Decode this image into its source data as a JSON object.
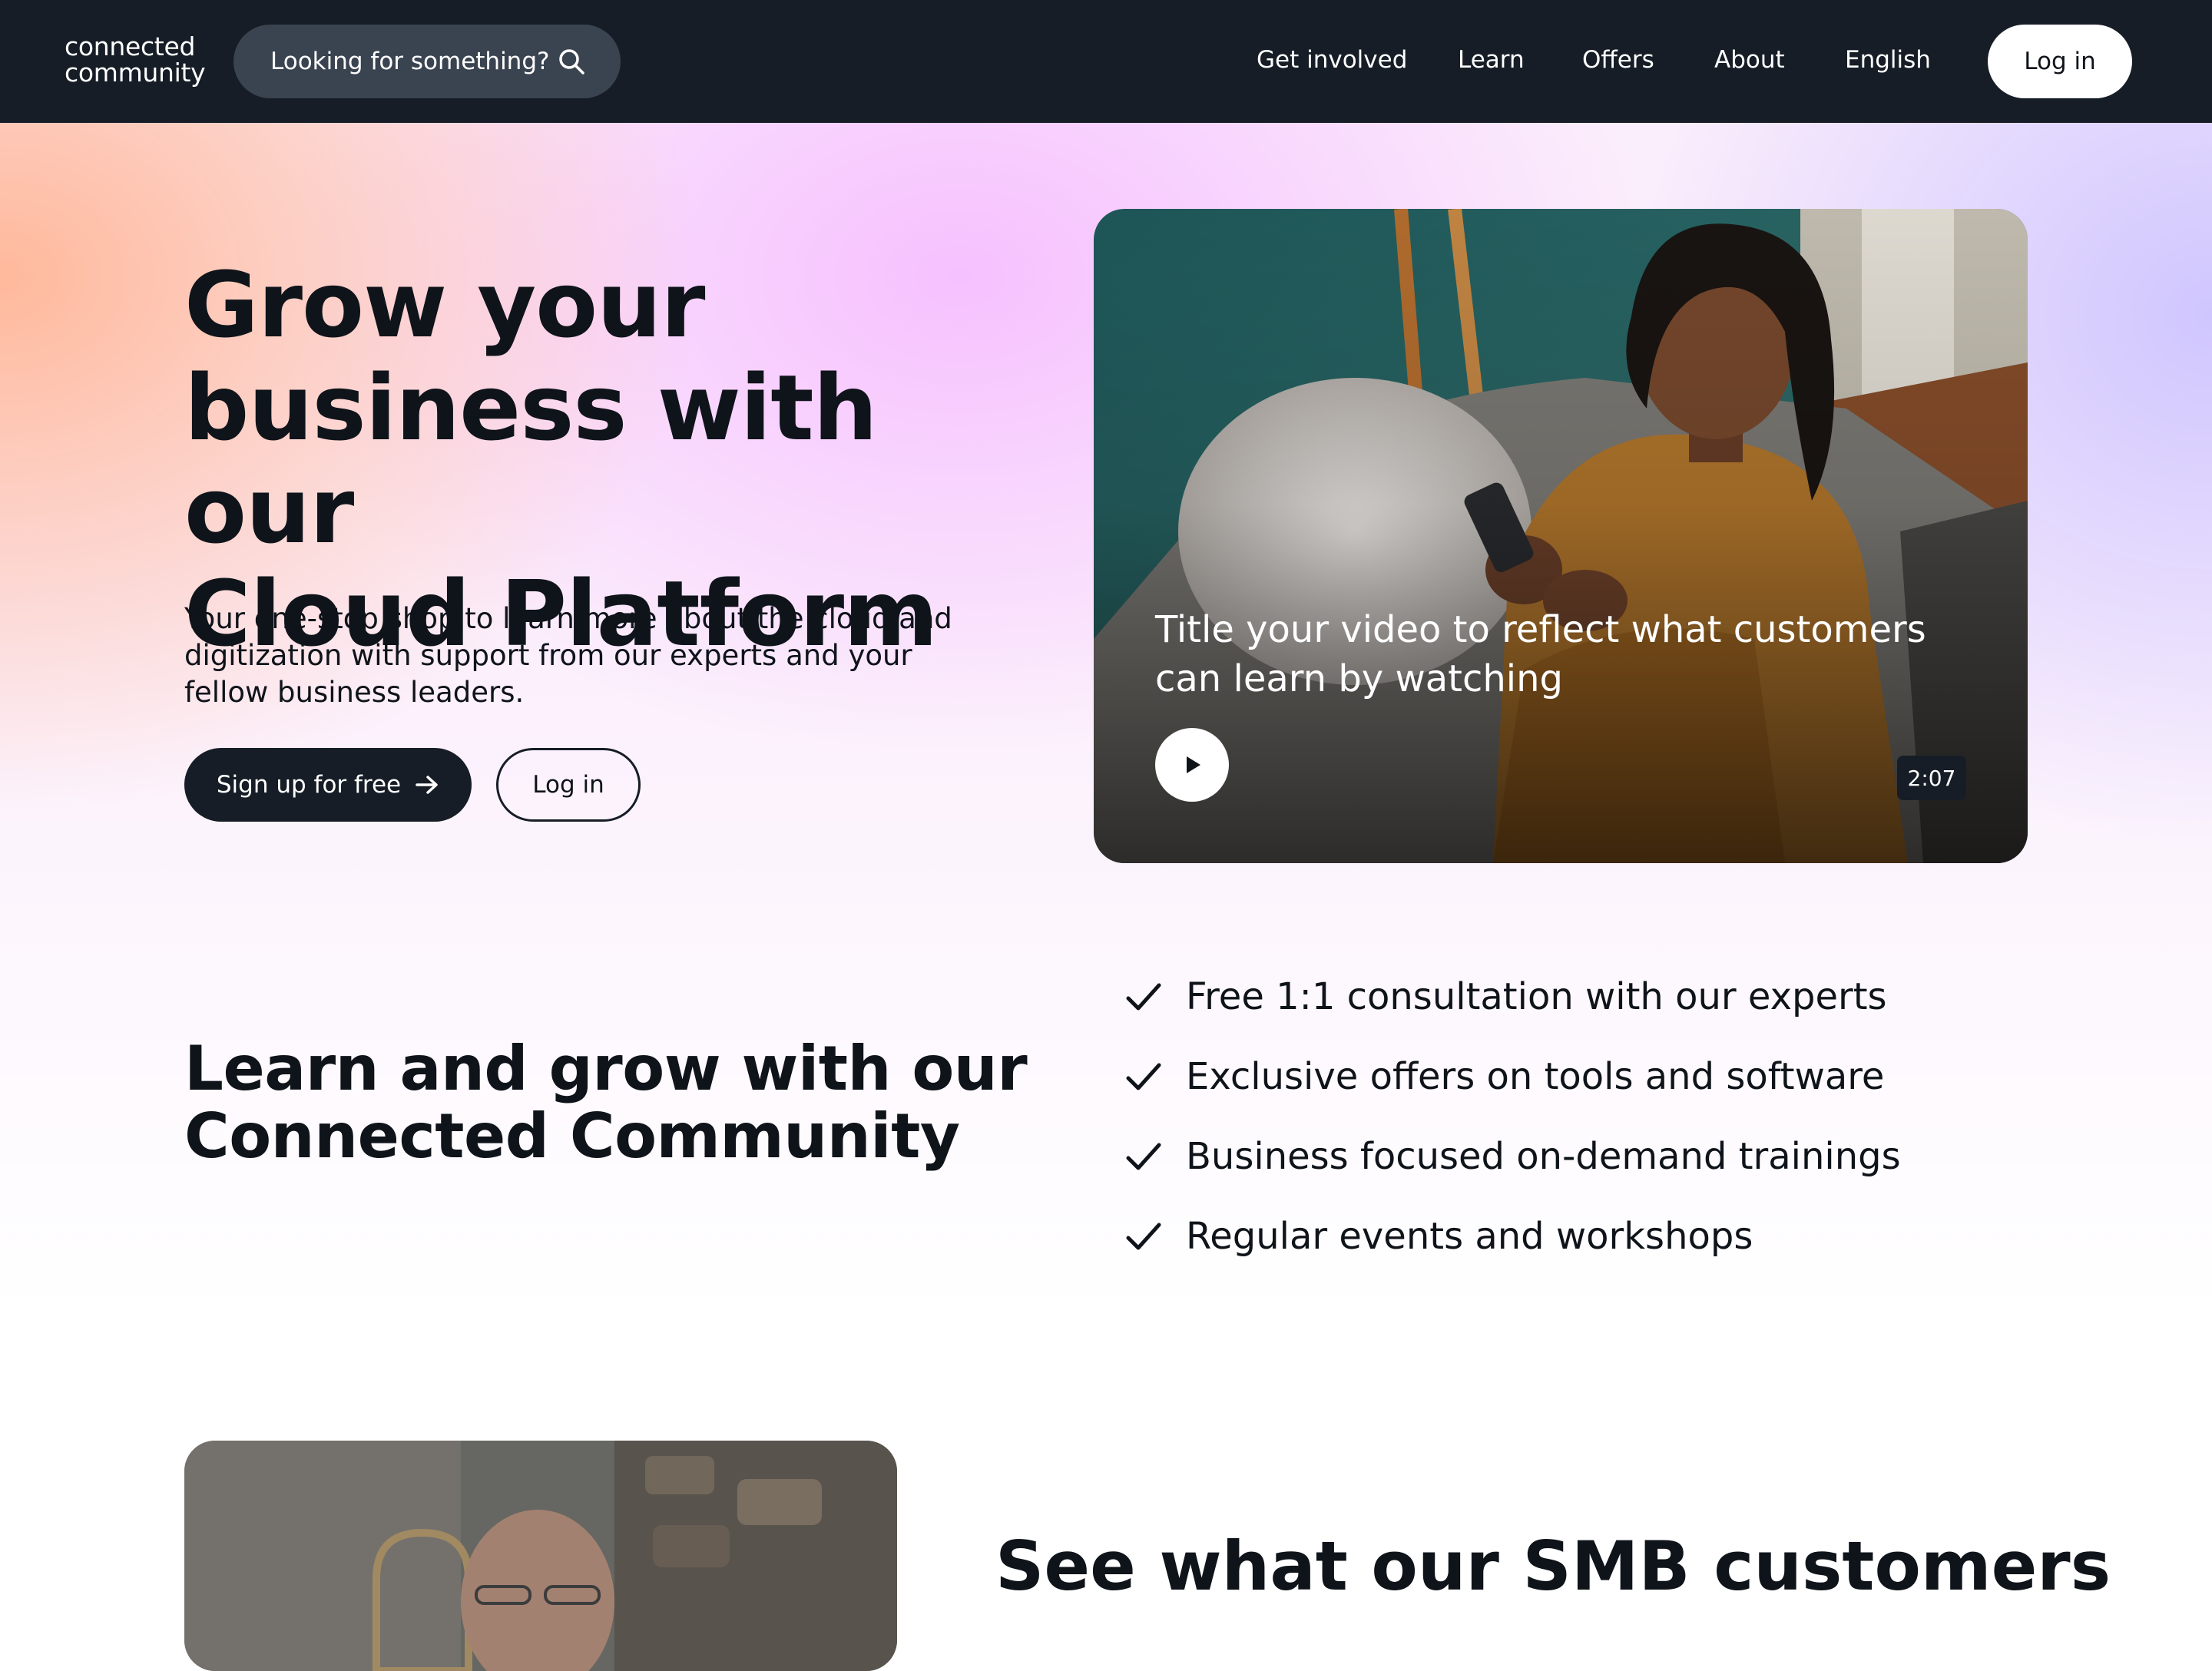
{
  "nav": {
    "logo_line1": "connected",
    "logo_line2": "community",
    "search_placeholder": "Looking for something?",
    "links": [
      "Get involved",
      "Learn",
      "Offers",
      "About",
      "English"
    ],
    "login_label": "Log in"
  },
  "hero": {
    "title_line1": "Grow your",
    "title_line2": "business with our",
    "title_line3": "Cloud Platform",
    "subtitle": "Your one-stop shop to learn more about the cloud and digitization with support from our experts and your fellow business leaders.",
    "signup_label": "Sign up for free",
    "login_label": "Log in"
  },
  "video": {
    "title": "Title your video to reflect what customers can learn by watching",
    "duration": "2:07"
  },
  "learn": {
    "title_line1": "Learn and grow with our",
    "title_line2": "Connected Community",
    "features": [
      "Free 1:1 consultation with our experts",
      "Exclusive offers on tools and software",
      "Business focused on-demand trainings",
      "Regular events and workshops"
    ]
  },
  "customers": {
    "title": "See what our SMB customers"
  },
  "colors": {
    "nav_bg": "#161d26",
    "search_bg": "#3a4350",
    "text": "#0f141a",
    "hero_peach": "#ffb696",
    "hero_pink": "#f6beff",
    "hero_lavender": "#cdc4ff"
  }
}
